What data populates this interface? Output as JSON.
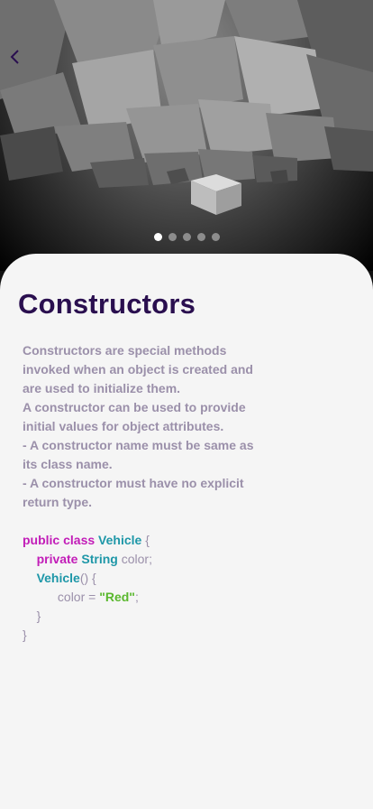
{
  "nav": {
    "back_icon": "chevron-left-icon"
  },
  "carousel": {
    "count": 5,
    "active_index": 0
  },
  "card": {
    "title": "Constructors",
    "description": [
      "Constructors are special methods invoked when an object is created and are used to initialize them.",
      "A constructor can be used to provide initial values for object attributes.",
      "- A constructor name must be same as its class name.",
      "- A constructor must have no explicit return type."
    ],
    "code": {
      "l1_kw": "public class",
      "l1_type": "Vehicle",
      "l1_brace": " {",
      "l2_kw": "private",
      "l2_type": "String",
      "l2_rest": " color;",
      "l3_fn": "Vehicle",
      "l3_rest": "() {",
      "l4_var": "color = ",
      "l4_str": "\"Red\"",
      "l4_end": ";",
      "l5": "}",
      "l6": "}"
    }
  },
  "colors": {
    "title": "#2a0f4f",
    "text": "#9b90aa",
    "keyword": "#c21db8",
    "type": "#1e97a8",
    "string": "#5ab82e",
    "card_bg": "#f5f5f5"
  }
}
